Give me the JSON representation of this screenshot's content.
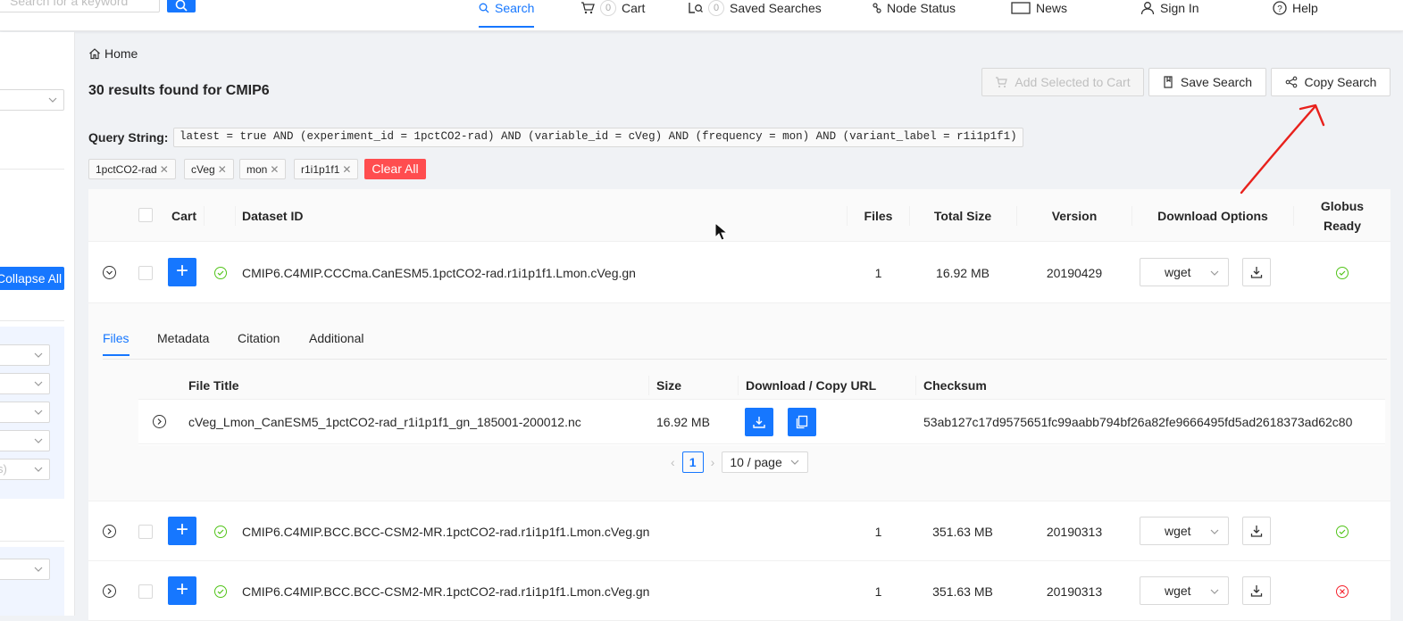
{
  "header": {
    "search_placeholder": "Search for a keyword",
    "nav": [
      {
        "label": "Search",
        "active": true
      },
      {
        "label": "Cart",
        "badge": "0"
      },
      {
        "label": "Saved Searches",
        "badge": "0"
      },
      {
        "label": "Node Status"
      },
      {
        "label": "News"
      },
      {
        "label": "Sign In"
      },
      {
        "label": "Help"
      }
    ]
  },
  "sidebar": {
    "collapse_label": "Collapse All",
    "partial_select_text": "s)"
  },
  "main": {
    "breadcrumb": "Home",
    "results_title": "30 results found for CMIP6",
    "buttons": {
      "add_to_cart": "Add Selected to Cart",
      "save_search": "Save Search",
      "copy_search": "Copy Search"
    },
    "query_label": "Query String:",
    "query_string": "latest = true AND (experiment_id = 1pctCO2-rad) AND (variable_id = cVeg) AND (frequency = mon) AND (variant_label = r1i1p1f1)",
    "tags": [
      "1pctCO2-rad",
      "cVeg",
      "mon",
      "r1i1p1f1"
    ],
    "clear_all": "Clear All"
  },
  "table": {
    "headers": {
      "cart": "Cart",
      "dataset_id": "Dataset ID",
      "files": "Files",
      "total_size": "Total Size",
      "version": "Version",
      "download_options": "Download Options",
      "globus_ready_1": "Globus",
      "globus_ready_2": "Ready"
    },
    "rows": [
      {
        "dataset_id": "CMIP6.C4MIP.CCCma.CanESM5.1pctCO2-rad.r1i1p1f1.Lmon.cVeg.gn",
        "files": "1",
        "total_size": "16.92 MB",
        "version": "20190429",
        "download": "wget",
        "globus_ready": true
      },
      {
        "dataset_id": "CMIP6.C4MIP.BCC.BCC-CSM2-MR.1pctCO2-rad.r1i1p1f1.Lmon.cVeg.gn",
        "files": "1",
        "total_size": "351.63 MB",
        "version": "20190313",
        "download": "wget",
        "globus_ready": true
      },
      {
        "dataset_id": "CMIP6.C4MIP.BCC.BCC-CSM2-MR.1pctCO2-rad.r1i1p1f1.Lmon.cVeg.gn",
        "files": "1",
        "total_size": "351.63 MB",
        "version": "20190313",
        "download": "wget",
        "globus_ready": false
      }
    ]
  },
  "expanded": {
    "tabs": [
      "Files",
      "Metadata",
      "Citation",
      "Additional"
    ],
    "active_tab": "Files",
    "file_headers": {
      "title": "File Title",
      "size": "Size",
      "download": "Download / Copy URL",
      "checksum": "Checksum"
    },
    "files": [
      {
        "title": "cVeg_Lmon_CanESM5_1pctCO2-rad_r1i1p1f1_gn_185001-200012.nc",
        "size": "16.92 MB",
        "checksum": "53ab127c17d9575651fc99aabb794bf26a82fe9666495fd5ad2618373ad62c80"
      }
    ],
    "pagination": {
      "current_page": "1",
      "page_size": "10 / page"
    }
  },
  "colors": {
    "primary": "#1677ff",
    "danger": "#ff4d4f",
    "success": "#52c41a",
    "error": "#f5222d",
    "annotation": "#e8211c"
  }
}
